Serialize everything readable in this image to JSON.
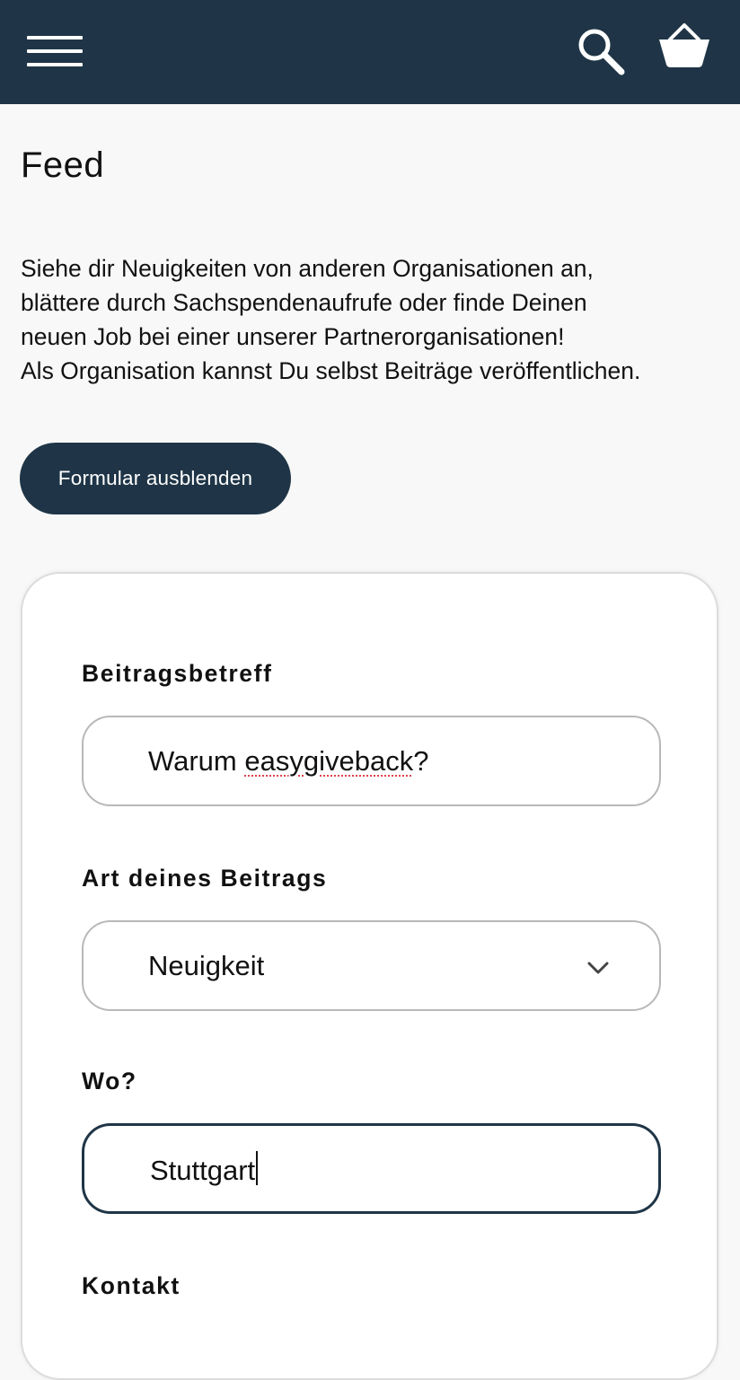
{
  "header": {
    "menu_icon": "hamburger-menu-icon",
    "search_icon": "search-icon",
    "basket_icon": "shopping-basket-icon",
    "background_color": "#1f3547"
  },
  "page": {
    "title": "Feed",
    "intro_lines": [
      "Siehe dir Neuigkeiten von anderen Organisationen an,",
      "blättere durch Sachspendenaufrufe oder finde Deinen",
      "neuen Job bei einer unserer Partnerorganisationen!",
      "Als Organisation kannst Du selbst Beiträge veröffentlichen."
    ],
    "toggle_form_label": "Formular ausblenden"
  },
  "form": {
    "subject": {
      "label": "Beitragsbetreff",
      "value_prefix": "Warum ",
      "value_misspelled": "easygiveback",
      "value_suffix": "?"
    },
    "post_type": {
      "label": "Art deines Beitrags",
      "selected": "Neuigkeit",
      "icon": "chevron-down-icon"
    },
    "location": {
      "label": "Wo?",
      "value": "Stuttgart"
    },
    "contact": {
      "label": "Kontakt"
    }
  },
  "colors": {
    "accent": "#1f3547",
    "page_background": "#f8f8f8",
    "focus_border": "#1f3547",
    "spellcheck_underline": "#e0404a"
  }
}
